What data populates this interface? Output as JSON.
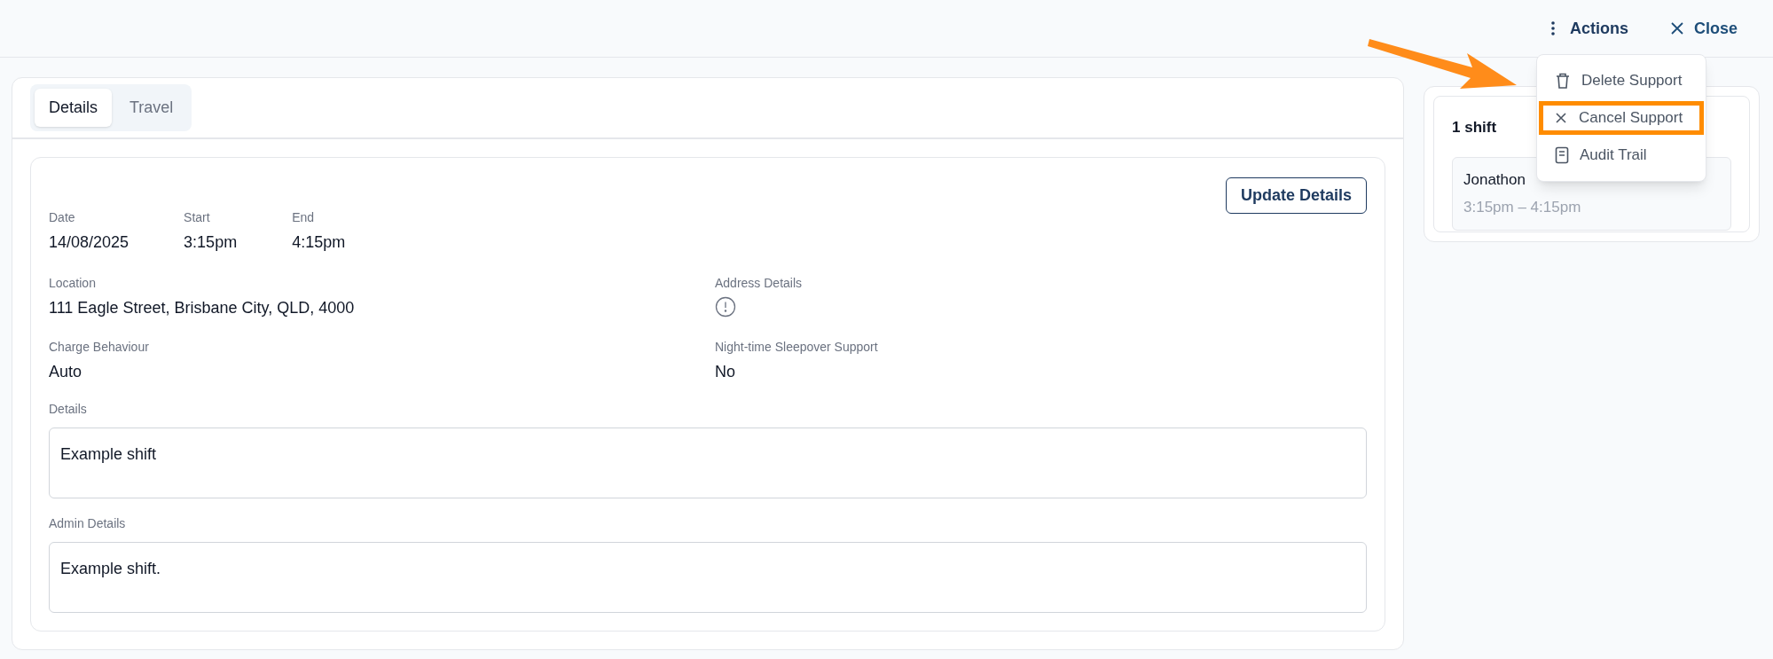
{
  "header": {
    "actions_label": "Actions",
    "close_label": "Close"
  },
  "actions_menu": [
    {
      "label": "Delete Support",
      "kind": "delete",
      "highlighted": false
    },
    {
      "label": "Cancel Support",
      "kind": "cancel",
      "highlighted": true
    },
    {
      "label": "Audit Trail",
      "kind": "audit",
      "highlighted": false
    }
  ],
  "tabs": [
    {
      "label": "Details",
      "selected": true
    },
    {
      "label": "Travel",
      "selected": false
    }
  ],
  "update_button": "Update Details",
  "time_fields": [
    {
      "label": "Date",
      "value": "14/08/2025"
    },
    {
      "label": "Start",
      "value": "3:15pm"
    },
    {
      "label": "End",
      "value": "4:15pm"
    }
  ],
  "location": {
    "label": "Location",
    "value": "111 Eagle Street, Brisbane City, QLD, 4000"
  },
  "address_details": {
    "label": "Address Details"
  },
  "charge_behaviour": {
    "label": "Charge Behaviour",
    "value": "Auto"
  },
  "sleepover": {
    "label": "Night-time Sleepover Support",
    "value": "No"
  },
  "details": {
    "label": "Details",
    "value": "Example shift"
  },
  "admin_details": {
    "label": "Admin Details",
    "value": "Example shift."
  },
  "shifts": {
    "title": "1 shift",
    "items": [
      {
        "name": "Jonathon",
        "time": "3:15pm – 4:15pm"
      }
    ]
  }
}
